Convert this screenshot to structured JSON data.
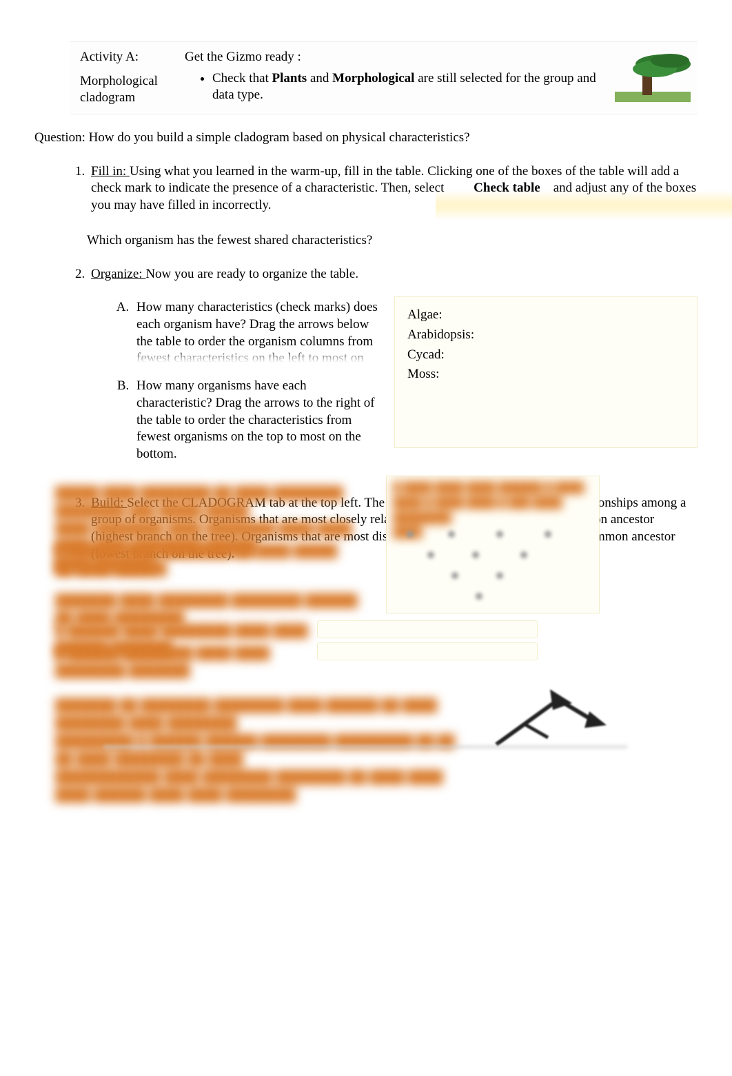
{
  "header": {
    "activity_label": "Activity A:",
    "activity_name_l1": "Morphological",
    "activity_name_l2": "cladogram",
    "gizmo_title": "Get the Gizmo ready   :",
    "gizmo_bullet_pre": "Check that  ",
    "gizmo_bullet_b1": "Plants",
    "gizmo_bullet_mid1": "  and ",
    "gizmo_bullet_b2": "Morphological",
    "gizmo_bullet_mid2": "    are still selected for the group and data type."
  },
  "question": "Question: How do you build a simple cladogram based on physical characteristics?",
  "q1": {
    "lead": "Fill in: ",
    "body_a": "Using what you learned in the warm-up, fill in the table. Clicking one of the boxes of the table will add a check mark to indicate the presence of a characteristic. Then, select ",
    "btn": "Check table",
    "body_b": " and adjust any of the boxes you may have filled in incorrectly.",
    "which": "Which organism has the fewest shared characteristics?"
  },
  "q2": {
    "lead": "Organize: ",
    "body": "Now you are ready to organize the table.",
    "A": "How many characteristics (check marks) does each organism have? Drag the arrows below the table to order the organism columns from fewest characteristics on the left to most on the right.",
    "B": "How many organisms have each characteristic? Drag the arrows to the right of the table to order the characteristics from fewest organisms on the top to most on the bottom.",
    "box": {
      "algae": "Algae:",
      "arabidopsis": "Arabidopsis:",
      "cycad": "Cycad:",
      "moss": "Moss:"
    }
  },
  "q3": {
    "lead": "Build: ",
    "body": "Select the CLADOGRAM tab at the top left. The goal of a cladogram is to show the relationships among a group of organisms. Organisms that are most closely related should share the most recent common ancestor (highest branch on the tree). Organisms that are most distantly related should share the oldest common ancestor (lowest branch on the tree)."
  }
}
